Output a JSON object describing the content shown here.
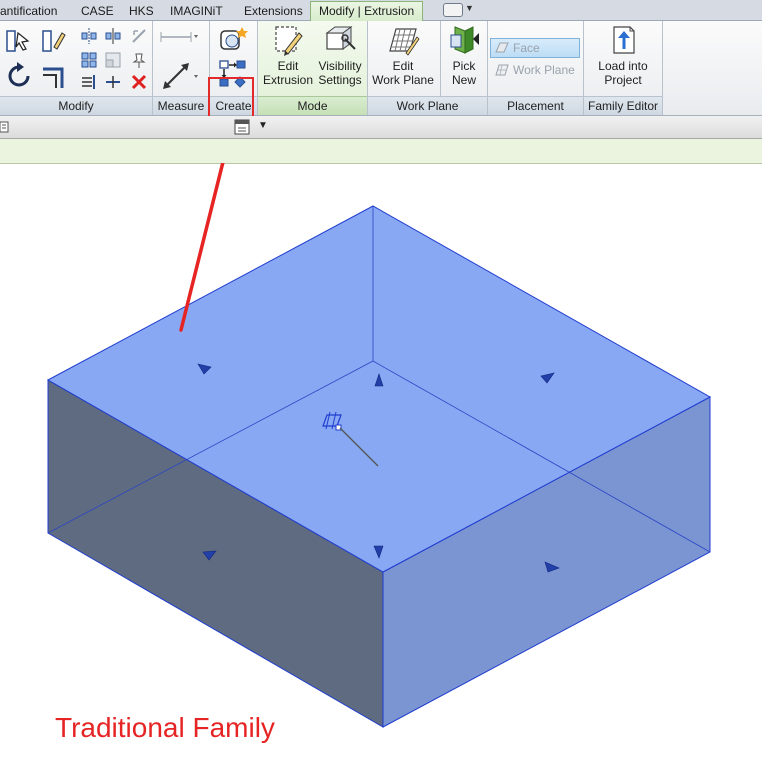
{
  "tabs": [
    {
      "label": "antification"
    },
    {
      "label": "CASE"
    },
    {
      "label": "HKS"
    },
    {
      "label": "IMAGINiT"
    },
    {
      "label": "Extensions"
    },
    {
      "label": "Modify | Extrusion"
    }
  ],
  "panels": {
    "modify": "Modify",
    "measure": "Measure",
    "create": "Create",
    "mode": "Mode",
    "work_plane": "Work Plane",
    "placement": "Placement",
    "family_editor": "Family Editor"
  },
  "buttons": {
    "edit_extrusion": [
      "Edit",
      "Extrusion"
    ],
    "visibility_settings": [
      "Visibility",
      "Settings"
    ],
    "edit_work_plane": [
      "Edit",
      "Work Plane"
    ],
    "pick_new": [
      "Pick",
      "New"
    ],
    "face": "Face",
    "work_plane": "Work Plane",
    "load_into_project": [
      "Load into",
      "Project"
    ]
  },
  "caption": "Traditional Family",
  "colors": {
    "annotation_red": "#e62424",
    "solid_top": "#89a8f3",
    "solid_front_left": "#5f6b80",
    "solid_front_right": "#7b95d3",
    "solid_edge": "#1f3dcf"
  }
}
